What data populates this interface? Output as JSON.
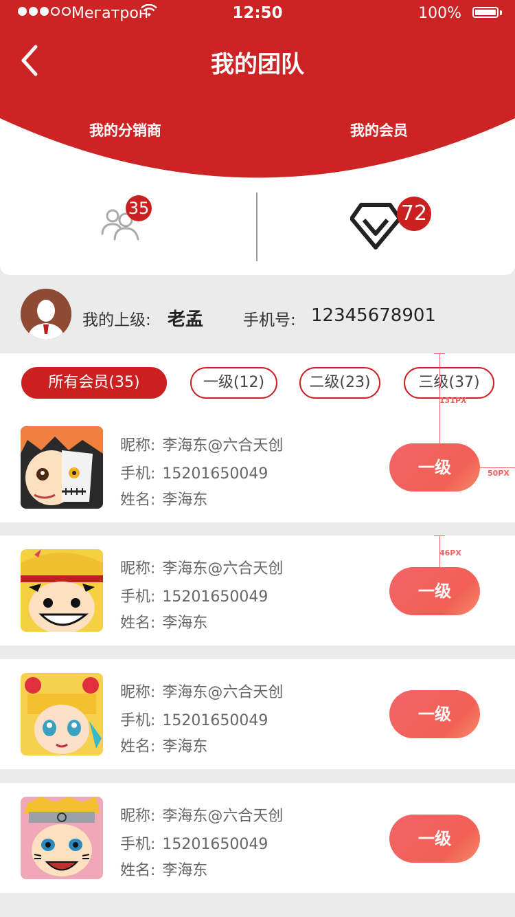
{
  "status_bar": {
    "carrier": "Мегатрон",
    "time": "12:50",
    "battery": "100%"
  },
  "header": {
    "title": "我的团队",
    "tabs": [
      {
        "label": "我的分销商"
      },
      {
        "label": "我的会员"
      }
    ]
  },
  "stats": {
    "distributors_count": "35",
    "members_count": "72"
  },
  "superior": {
    "label": "我的上级:",
    "name": "老孟",
    "phone_label": "手机号:",
    "phone": "12345678901"
  },
  "filters": [
    {
      "label": "所有会员(35)",
      "active": true
    },
    {
      "label": "一级(12)",
      "active": false
    },
    {
      "label": "二级(23)",
      "active": false
    },
    {
      "label": "三级(37)",
      "active": false
    }
  ],
  "members": [
    {
      "nick_label": "昵称:",
      "nick": "李海东@六合天创",
      "phone_label": "手机:",
      "phone": "15201650049",
      "name_label": "姓名:",
      "name": "李海东",
      "level": "一级",
      "avatar": "ichigo-avatar"
    },
    {
      "nick_label": "昵称:",
      "nick": "李海东@六合天创",
      "phone_label": "手机:",
      "phone": "15201650049",
      "name_label": "姓名:",
      "name": "李海东",
      "level": "一级",
      "avatar": "luffy-avatar"
    },
    {
      "nick_label": "昵称:",
      "nick": "李海东@六合天创",
      "phone_label": "手机:",
      "phone": "15201650049",
      "name_label": "姓名:",
      "name": "李海东",
      "level": "一级",
      "avatar": "sailor-moon-avatar"
    },
    {
      "nick_label": "昵称:",
      "nick": "李海东@六合天创",
      "phone_label": "手机:",
      "phone": "15201650049",
      "name_label": "姓名:",
      "name": "李海东",
      "level": "一级",
      "avatar": "naruto-avatar"
    }
  ],
  "annotations": {
    "a1": "131PX",
    "a2": "50PX",
    "a3": "46PX"
  },
  "colors": {
    "brand_red": "#cc2020",
    "level_button": "#f16468"
  }
}
